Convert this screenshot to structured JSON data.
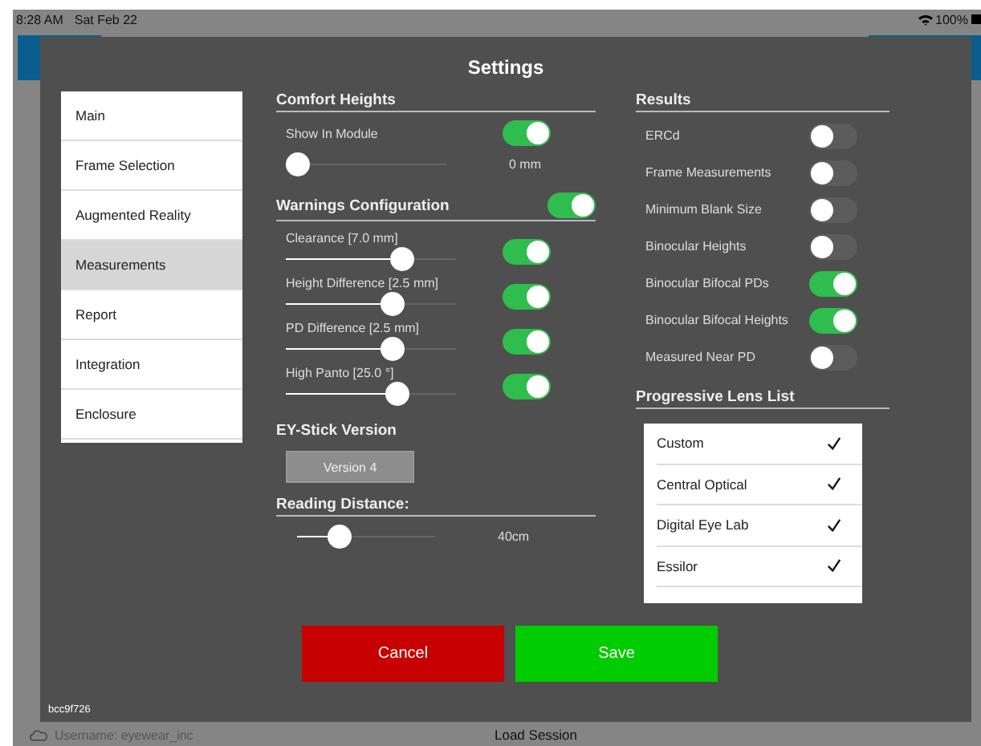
{
  "status_bar": {
    "time": "8:28 AM",
    "date": "Sat Feb 22",
    "battery": "100%"
  },
  "dialog": {
    "title": "Settings",
    "sidebar": {
      "items": [
        {
          "label": "Main",
          "selected": false
        },
        {
          "label": "Frame Selection",
          "selected": false
        },
        {
          "label": "Augmented Reality",
          "selected": false
        },
        {
          "label": "Measurements",
          "selected": true
        },
        {
          "label": "Report",
          "selected": false
        },
        {
          "label": "Integration",
          "selected": false
        },
        {
          "label": "Enclosure",
          "selected": false
        }
      ]
    },
    "comfort_heights": {
      "heading": "Comfort Heights",
      "show_label": "Show In Module",
      "show_on": true,
      "level": 0,
      "reading": "0 mm"
    },
    "warnings": {
      "heading": "Warnings Configuration",
      "on": true,
      "rows": [
        {
          "label": "Clearance  [7.0 mm]",
          "on": true,
          "level": 0.68
        },
        {
          "label": "Height Difference  [2.5 mm]",
          "on": true,
          "level": 0.62
        },
        {
          "label": "PD Difference  [2.5 mm]",
          "on": true,
          "level": 0.62
        },
        {
          "label": "High Panto  [25.0 °]",
          "on": true,
          "level": 0.65
        }
      ]
    },
    "ey_stick": {
      "heading": "EY-Stick Version",
      "button": "Version 4"
    },
    "reading_distance": {
      "heading": "Reading Distance:",
      "level": 0.3,
      "reading": "40cm"
    },
    "results": {
      "heading": "Results",
      "rows": [
        {
          "label": "ERCd",
          "on": false
        },
        {
          "label": "Frame Measurements",
          "on": false
        },
        {
          "label": "Minimum Blank Size",
          "on": false
        },
        {
          "label": "Binocular Heights",
          "on": false
        },
        {
          "label": "Binocular Bifocal PDs",
          "on": true
        },
        {
          "label": "Binocular Bifocal Heights",
          "on": true
        },
        {
          "label": "Measured Near PD",
          "on": false
        }
      ]
    },
    "lens_list": {
      "heading": "Progressive Lens List",
      "items": [
        {
          "name": "Custom",
          "checked": true
        },
        {
          "name": "Central Optical",
          "checked": true
        },
        {
          "name": "Digital Eye Lab",
          "checked": true
        },
        {
          "name": "Essilor",
          "checked": true
        }
      ]
    },
    "version": "bcc9f726",
    "buttons": [
      {
        "label": "Cancel",
        "kind": "cancel"
      },
      {
        "label": "Save",
        "kind": "save"
      }
    ]
  },
  "bottom_bar": {
    "user": "Username: eyewear_inc",
    "action": "Load Session"
  }
}
